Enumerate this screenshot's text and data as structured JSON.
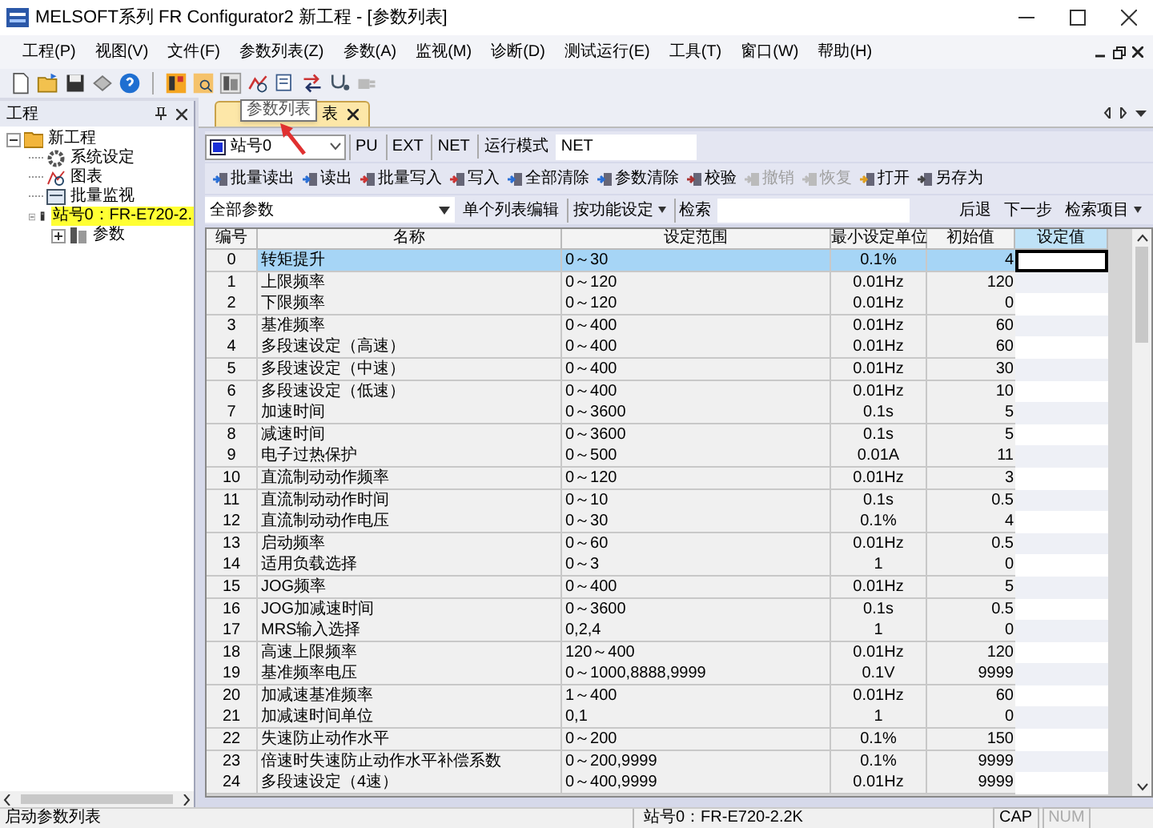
{
  "window": {
    "title": "MELSOFT系列 FR Configurator2 新工程 - [参数列表]"
  },
  "menu": [
    {
      "label": "工程(P)"
    },
    {
      "label": "视图(V)"
    },
    {
      "label": "文件(F)"
    },
    {
      "label": "参数列表(Z)"
    },
    {
      "label": "参数(A)"
    },
    {
      "label": "监视(M)"
    },
    {
      "label": "诊断(D)"
    },
    {
      "label": "测试运行(E)"
    },
    {
      "label": "工具(T)"
    },
    {
      "label": "窗口(W)"
    },
    {
      "label": "帮助(H)"
    }
  ],
  "project_panel": {
    "title": "工程",
    "tree": [
      {
        "label": "新工程",
        "expanded": true,
        "selected": false,
        "children": [
          {
            "label": "系统设定",
            "selected": false
          },
          {
            "label": "图表",
            "selected": false
          },
          {
            "label": "批量监视",
            "selected": false
          },
          {
            "label": "站号0：FR-E720-2.",
            "expanded": true,
            "selected": true,
            "children": [
              {
                "label": "参数",
                "expanded": false,
                "selected": false
              }
            ]
          }
        ]
      }
    ]
  },
  "tab": {
    "label": "表",
    "tooltip": "参数列表"
  },
  "station_bar": {
    "station": "站号0",
    "modes": [
      "PU",
      "EXT",
      "NET"
    ],
    "run_mode_label": "运行模式",
    "run_mode_value": "NET"
  },
  "actions": [
    {
      "label": "批量读出",
      "disabled": false
    },
    {
      "label": "读出",
      "disabled": false
    },
    {
      "label": "批量写入",
      "disabled": false
    },
    {
      "label": "写入",
      "disabled": false
    },
    {
      "label": "全部清除",
      "disabled": false
    },
    {
      "label": "参数清除",
      "disabled": false
    },
    {
      "label": "校验",
      "disabled": false
    },
    {
      "label": "撤销",
      "disabled": true
    },
    {
      "label": "恢复",
      "disabled": true
    },
    {
      "label": "打开",
      "disabled": false
    },
    {
      "label": "另存为",
      "disabled": false
    }
  ],
  "filter_bar": {
    "filter": "全部参数",
    "edit_button": "单个列表编辑",
    "function_button": "按功能设定",
    "search_label": "检索",
    "back": "后退",
    "next": "下一步",
    "search_items": "检索项目"
  },
  "table": {
    "columns": [
      "编号",
      "名称",
      "设定范围",
      "最小设定单位",
      "初始值",
      "设定值"
    ],
    "rows": [
      {
        "no": "0",
        "name": "转矩提升",
        "range": "0～30",
        "unit": "0.1%",
        "initial": "4",
        "selected": true
      },
      {
        "no": "1",
        "name": "上限频率",
        "range": "0～120",
        "unit": "0.01Hz",
        "initial": "120",
        "selected": false
      },
      {
        "no": "2",
        "name": "下限频率",
        "range": "0～120",
        "unit": "0.01Hz",
        "initial": "0",
        "selected": false
      },
      {
        "no": "3",
        "name": "基准频率",
        "range": "0～400",
        "unit": "0.01Hz",
        "initial": "60",
        "selected": false
      },
      {
        "no": "4",
        "name": "多段速设定（高速）",
        "range": "0～400",
        "unit": "0.01Hz",
        "initial": "60",
        "selected": false
      },
      {
        "no": "5",
        "name": "多段速设定（中速）",
        "range": "0～400",
        "unit": "0.01Hz",
        "initial": "30",
        "selected": false
      },
      {
        "no": "6",
        "name": "多段速设定（低速）",
        "range": "0～400",
        "unit": "0.01Hz",
        "initial": "10",
        "selected": false
      },
      {
        "no": "7",
        "name": "加速时间",
        "range": "0～3600",
        "unit": "0.1s",
        "initial": "5",
        "selected": false
      },
      {
        "no": "8",
        "name": "减速时间",
        "range": "0～3600",
        "unit": "0.1s",
        "initial": "5",
        "selected": false
      },
      {
        "no": "9",
        "name": "电子过热保护",
        "range": "0～500",
        "unit": "0.01A",
        "initial": "11",
        "selected": false
      },
      {
        "no": "10",
        "name": "直流制动动作频率",
        "range": "0～120",
        "unit": "0.01Hz",
        "initial": "3",
        "selected": false
      },
      {
        "no": "11",
        "name": "直流制动动作时间",
        "range": "0～10",
        "unit": "0.1s",
        "initial": "0.5",
        "selected": false
      },
      {
        "no": "12",
        "name": "直流制动动作电压",
        "range": "0～30",
        "unit": "0.1%",
        "initial": "4",
        "selected": false
      },
      {
        "no": "13",
        "name": "启动频率",
        "range": "0～60",
        "unit": "0.01Hz",
        "initial": "0.5",
        "selected": false
      },
      {
        "no": "14",
        "name": "适用负载选择",
        "range": "0～3",
        "unit": "1",
        "initial": "0",
        "selected": false
      },
      {
        "no": "15",
        "name": "JOG频率",
        "range": "0～400",
        "unit": "0.01Hz",
        "initial": "5",
        "selected": false
      },
      {
        "no": "16",
        "name": "JOG加减速时间",
        "range": "0～3600",
        "unit": "0.1s",
        "initial": "0.5",
        "selected": false
      },
      {
        "no": "17",
        "name": "MRS输入选择",
        "range": "0,2,4",
        "unit": "1",
        "initial": "0",
        "selected": false
      },
      {
        "no": "18",
        "name": "高速上限频率",
        "range": "120～400",
        "unit": "0.01Hz",
        "initial": "120",
        "selected": false
      },
      {
        "no": "19",
        "name": "基准频率电压",
        "range": "0～1000,8888,9999",
        "unit": "0.1V",
        "initial": "9999",
        "selected": false
      },
      {
        "no": "20",
        "name": "加减速基准频率",
        "range": "1～400",
        "unit": "0.01Hz",
        "initial": "60",
        "selected": false
      },
      {
        "no": "21",
        "name": "加减速时间单位",
        "range": "0,1",
        "unit": "1",
        "initial": "0",
        "selected": false
      },
      {
        "no": "22",
        "name": "失速防止动作水平",
        "range": "0～200",
        "unit": "0.1%",
        "initial": "150",
        "selected": false
      },
      {
        "no": "23",
        "name": "倍速时失速防止动作水平补偿系数",
        "range": "0～200,9999",
        "unit": "0.1%",
        "initial": "9999",
        "selected": false
      },
      {
        "no": "24",
        "name": "多段速设定（4速）",
        "range": "0～400,9999",
        "unit": "0.01Hz",
        "initial": "9999",
        "selected": false
      }
    ]
  },
  "status_bar": {
    "message": "启动参数列表",
    "station": "站号0：FR-E720-2.2K",
    "indicators": [
      {
        "label": "CAP",
        "on": true
      },
      {
        "label": "NUM",
        "on": false
      }
    ]
  }
}
